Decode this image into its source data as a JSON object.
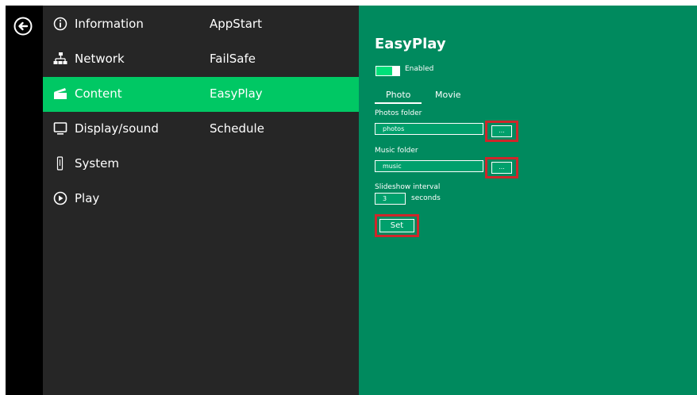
{
  "menu": {
    "items": [
      {
        "label": "Information",
        "icon": "info-icon",
        "sub": "AppStart"
      },
      {
        "label": "Network",
        "icon": "network-icon",
        "sub": "FailSafe"
      },
      {
        "label": "Content",
        "icon": "clapperboard-icon",
        "sub": "EasyPlay",
        "active": true
      },
      {
        "label": "Display/sound",
        "icon": "monitor-icon",
        "sub": "Schedule"
      },
      {
        "label": "System",
        "icon": "phone-icon",
        "sub": ""
      },
      {
        "label": "Play",
        "icon": "play-icon",
        "sub": ""
      }
    ]
  },
  "panel": {
    "title": "EasyPlay",
    "toggle_label": "Enabled",
    "toggle_on": true,
    "tabs": [
      {
        "label": "Photo",
        "active": true
      },
      {
        "label": "Movie"
      }
    ],
    "photos_folder_label": "Photos folder",
    "photos_folder_value": "photos",
    "music_folder_label": "Music folder",
    "music_folder_value": "music",
    "browse_label": "...",
    "interval_label": "Slideshow interval",
    "interval_value": "3",
    "interval_unit": "seconds",
    "set_label": "Set"
  },
  "colors": {
    "panel_bg": "#008a5e",
    "menu_bg": "#262626",
    "active_item": "#00c864",
    "highlight": "#d0262a"
  }
}
